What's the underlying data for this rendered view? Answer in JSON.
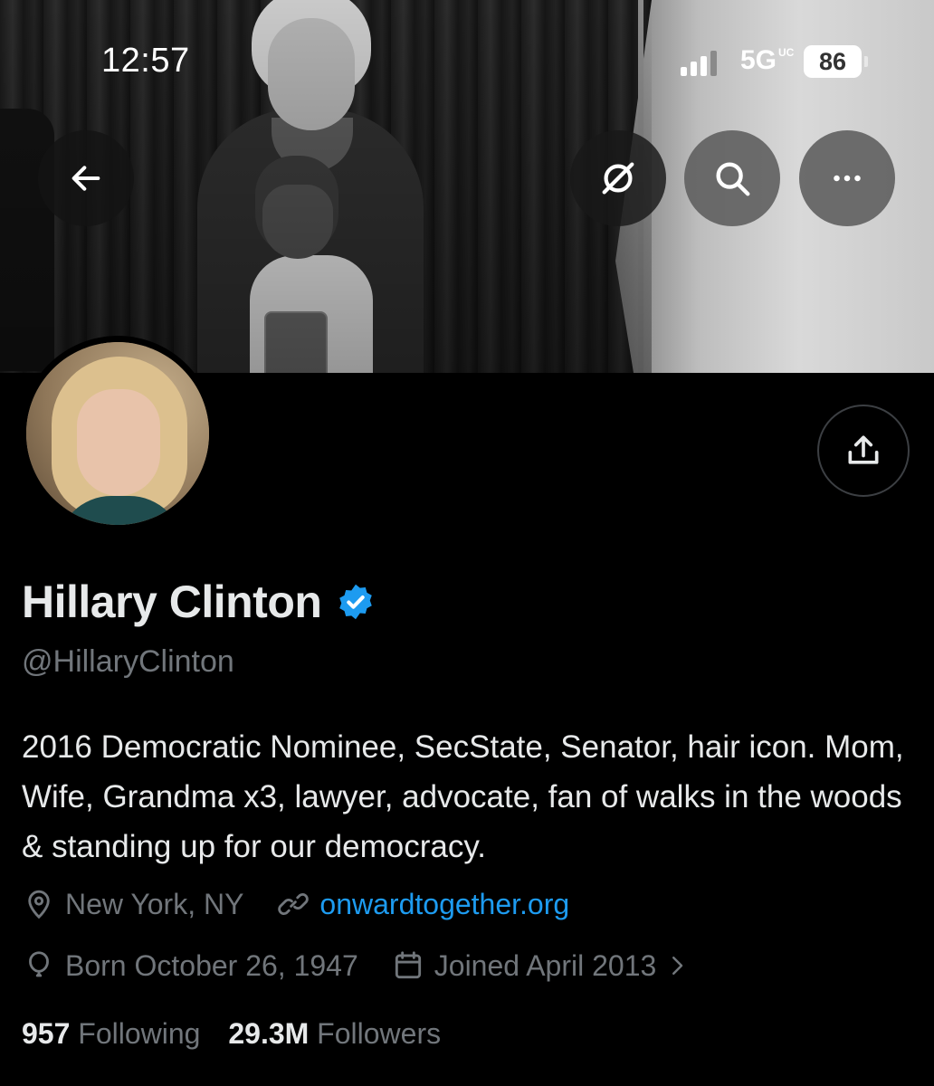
{
  "status_bar": {
    "time": "12:57",
    "network": "5G",
    "network_suffix": "UC",
    "battery": "86"
  },
  "header": {
    "back_icon": "arrow-left-icon",
    "grok_icon": "slash-circle-icon",
    "search_icon": "search-icon",
    "more_icon": "more-horizontal-icon"
  },
  "profile": {
    "name": "Hillary Clinton",
    "verified": true,
    "handle": "@HillaryClinton",
    "bio": "2016 Democratic Nominee, SecState, Senator, hair icon. Mom, Wife, Grandma x3, lawyer, advocate, fan of walks in the woods & standing up for our democracy.",
    "location": "New York, NY",
    "website": "onwardtogether.org",
    "born": "Born October 26, 1947",
    "joined": "Joined April 2013",
    "following_count": "957",
    "following_label": "Following",
    "followers_count": "29.3M",
    "followers_label": "Followers"
  },
  "colors": {
    "background": "#000000",
    "text_primary": "#e7e9ea",
    "text_secondary": "#71767b",
    "link": "#1d9bf0",
    "verified": "#1d9bf0"
  }
}
